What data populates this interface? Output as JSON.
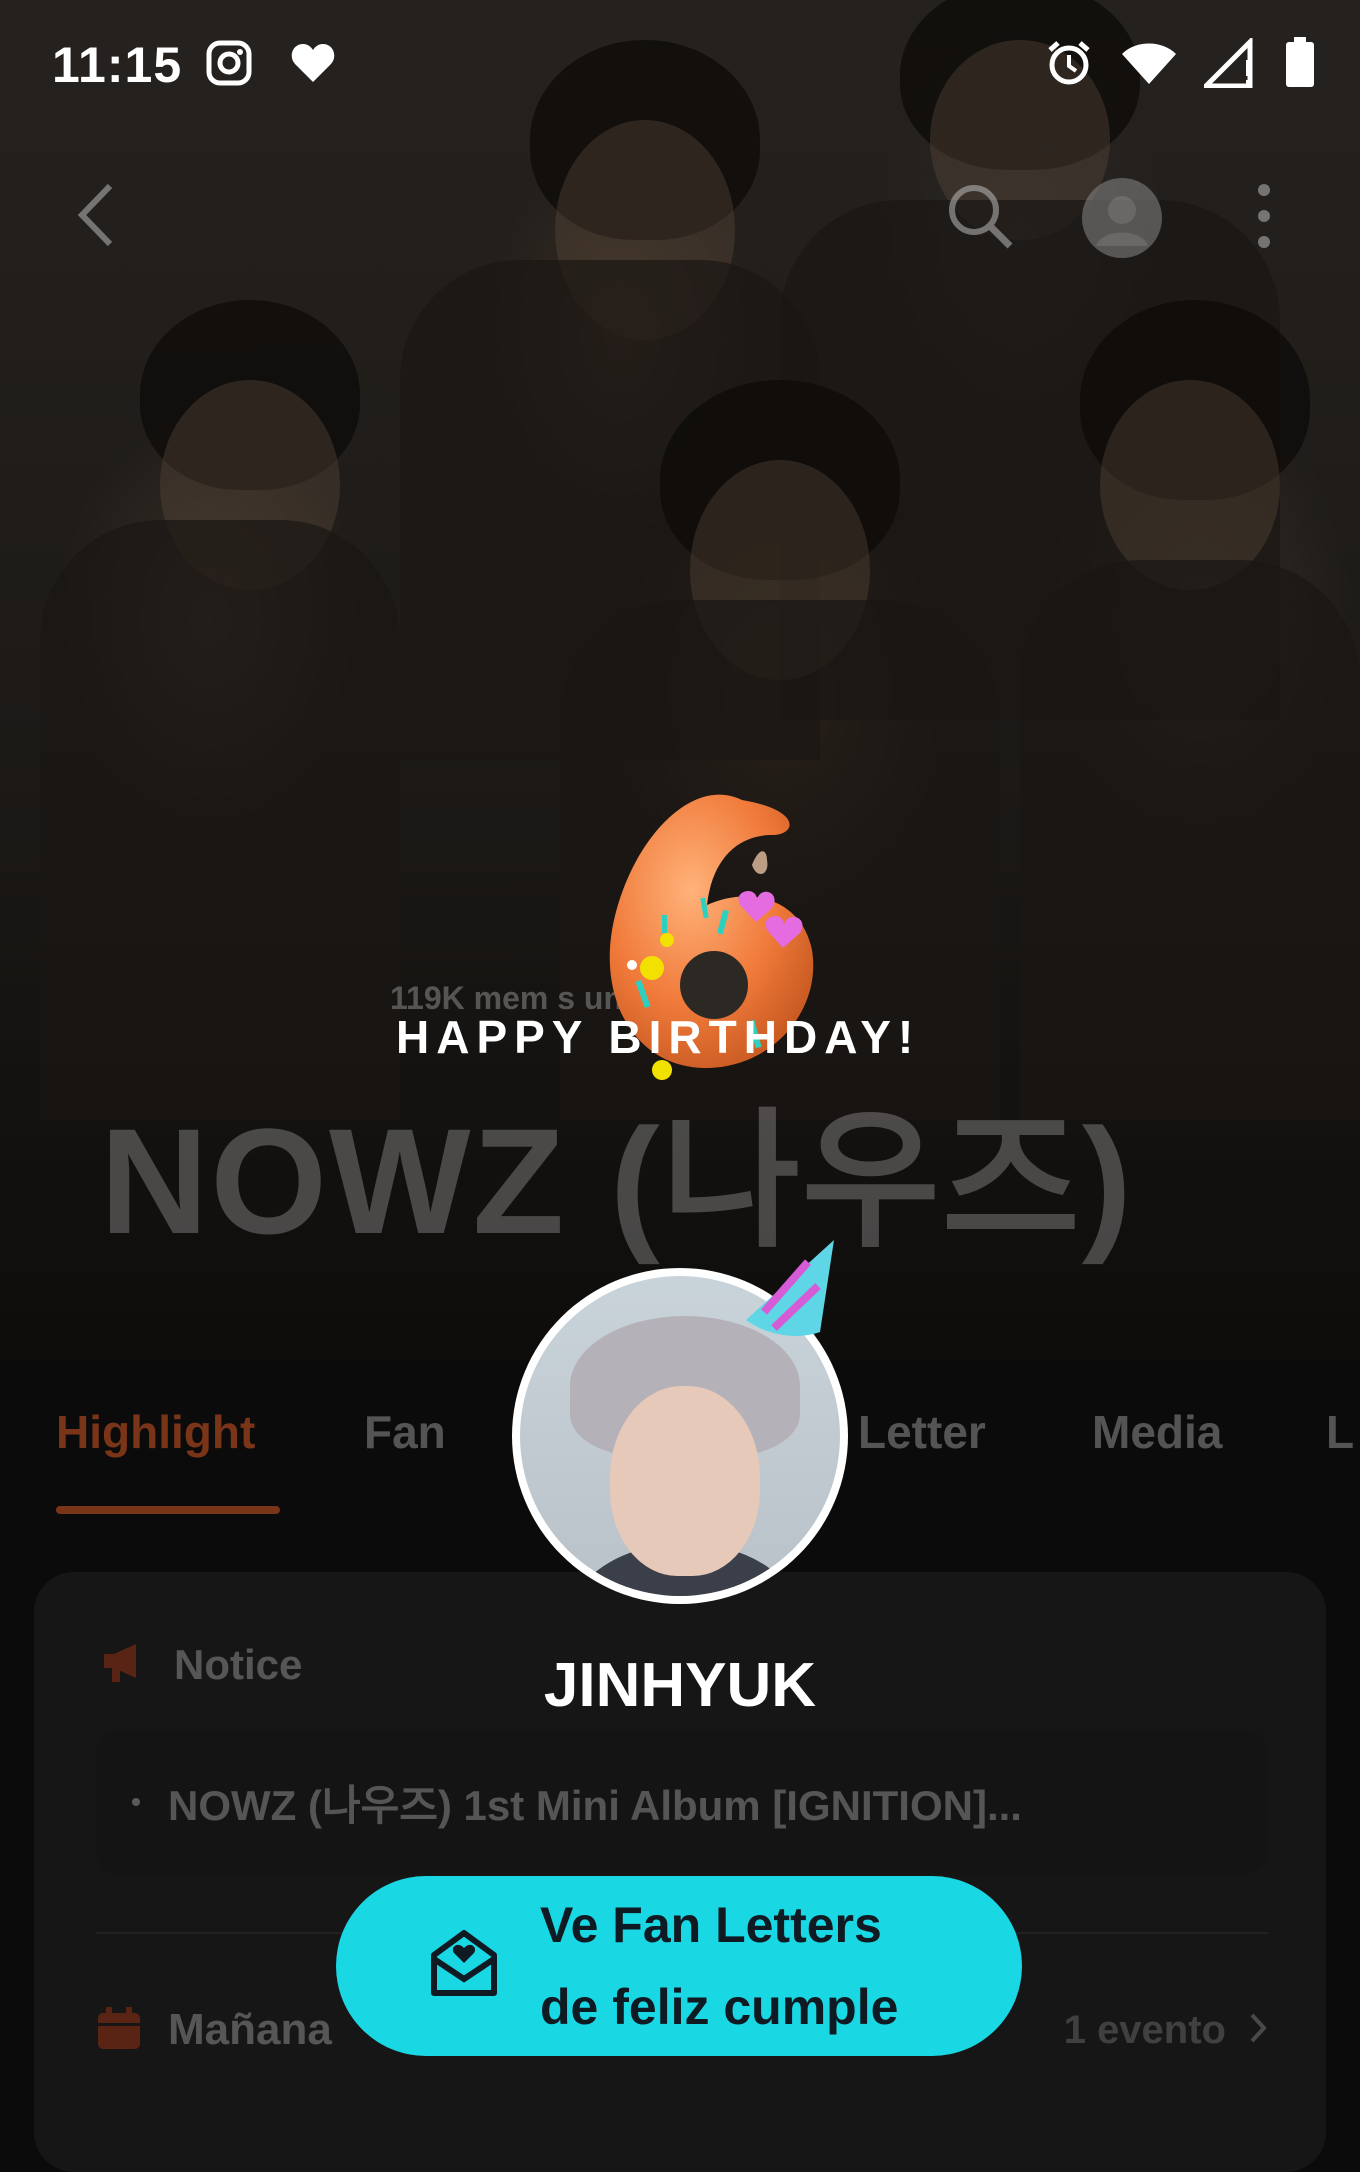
{
  "status_bar": {
    "time": "11:15",
    "left_icons": [
      "instagram-icon",
      "heart-icon"
    ],
    "right_icons": [
      "alarm-icon",
      "wifi-icon",
      "signal-icon",
      "battery-icon"
    ]
  },
  "top_nav": {
    "icons": [
      "back-icon",
      "search-icon",
      "profile-icon",
      "more-icon"
    ]
  },
  "community": {
    "members_text": "119K mem        s uniste",
    "title": "NOWZ (나우즈)"
  },
  "birthday": {
    "banner": "HAPPY BIRTHDAY!",
    "balloon_number": "6",
    "member_name": "JINHYUK"
  },
  "tabs": [
    {
      "label": "Highlight",
      "active": true
    },
    {
      "label": "Fan",
      "active": false
    },
    {
      "label": "Letter",
      "active": false
    },
    {
      "label": "Media",
      "active": false
    },
    {
      "label": "L",
      "active": false
    }
  ],
  "notice": {
    "label": "Notice",
    "items": [
      "NOWZ (나우즈) 1st Mini Album [IGNITION]..."
    ]
  },
  "calendar": {
    "label": "Mañana",
    "count": "1 evento"
  },
  "cta": {
    "label_line1": "Ve Fan Letters",
    "label_line2": "de feliz cumple"
  },
  "colors": {
    "accent": "#7a3519",
    "cta": "#19d7e3",
    "background": "#0b0b0b"
  }
}
